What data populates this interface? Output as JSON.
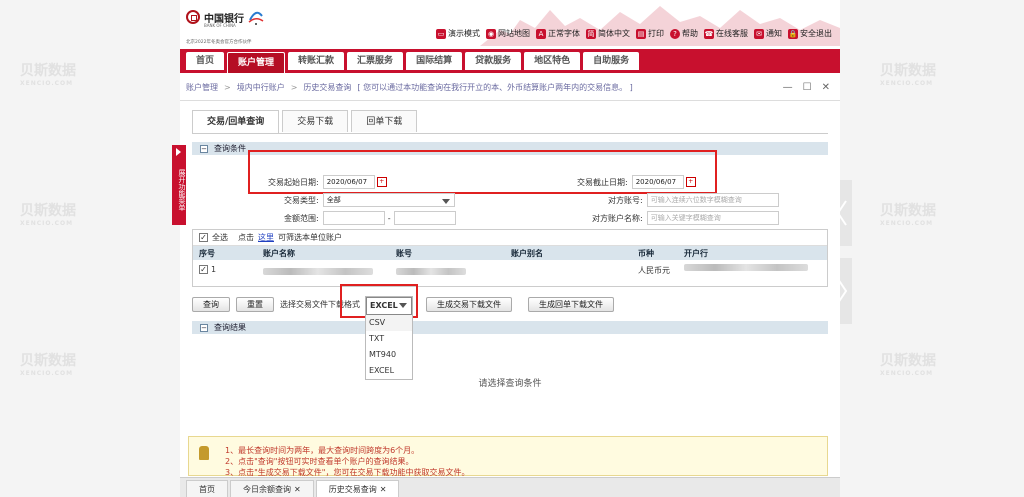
{
  "header": {
    "bank_name": "中国银行",
    "bank_name_en": "BANK OF CHINA",
    "slogan": "北京2022年冬奥会官方合作伙伴",
    "olympic": "BEIJING 2022",
    "toolbar": [
      {
        "icon": "monitor-icon",
        "label": "演示模式"
      },
      {
        "icon": "map-icon",
        "label": "网站地图"
      },
      {
        "icon": "font-icon",
        "label": "正常字体"
      },
      {
        "icon": "language-icon",
        "label": "简体中文"
      },
      {
        "icon": "printer-icon",
        "label": "打印"
      },
      {
        "icon": "help-icon",
        "label": "帮助"
      },
      {
        "icon": "service-icon",
        "label": "在线客服"
      },
      {
        "icon": "mail-icon",
        "label": "通知"
      },
      {
        "icon": "lock-icon",
        "label": "安全退出"
      }
    ]
  },
  "nav": {
    "items": [
      "首页",
      "账户管理",
      "转账汇款",
      "汇票服务",
      "国际结算",
      "贷款服务",
      "地区特色",
      "自助服务"
    ],
    "active": "账户管理"
  },
  "breadcrumb": {
    "items": [
      "账户管理",
      "境内中行账户",
      "历史交易查询"
    ],
    "hint": "[ 您可以通过本功能查询在我行开立的本、外币结算账户两年内的交易信息。 ]"
  },
  "tabs": [
    "交易/回单查询",
    "交易下载",
    "回单下载"
  ],
  "side_button": "展开功能菜单",
  "query": {
    "title": "查询条件",
    "start_date_label": "交易起始日期:",
    "start_date": "2020/06/07",
    "end_date_label": "交易截止日期:",
    "end_date": "2020/06/07",
    "type_label": "交易类型:",
    "type_value": "全部",
    "counter_account_label": "对方账号:",
    "counter_account_placeholder": "可输入连续六位数字模糊查询",
    "amount_label": "金额范围:",
    "amount_sep": "-",
    "counter_name_label": "对方账户名称:",
    "counter_name_placeholder": "可输入关键字模糊查询"
  },
  "accounts": {
    "select_all": "全选",
    "click_prefix": "点击",
    "click_link": "这里",
    "click_suffix": "可筛选本单位账户",
    "columns": [
      "序号",
      "账户名称",
      "账号",
      "账户别名",
      "币种",
      "开户行"
    ],
    "rows": [
      {
        "index": "1",
        "currency": "人民币元"
      }
    ]
  },
  "actions": {
    "query": "查询",
    "reset": "重置",
    "format_label": "选择交易文件下载格式",
    "format_selected": "EXCEL",
    "format_options": [
      "CSV",
      "TXT",
      "MT940",
      "EXCEL"
    ],
    "generate_trade": "生成交易下载文件",
    "generate_receipt": "生成回单下载文件"
  },
  "result": {
    "title": "查询结果",
    "empty": "请选择查询条件"
  },
  "notice": [
    "1、最长查询时间为两年，最大查询时间跨度为6个月。",
    "2、点击\"查询\"按钮可实时查看单个账户的查询结果。",
    "3、点击\"生成交易下载文件\"，您可在交易下载功能中获取交易文件。"
  ],
  "bottom_tabs": [
    {
      "label": "首页",
      "closable": false
    },
    {
      "label": "今日余额查询",
      "closable": true
    },
    {
      "label": "历史交易查询",
      "closable": true
    }
  ],
  "watermark": {
    "cn": "贝斯数据",
    "en": "XENCIO.COM"
  },
  "colors": {
    "brand": "#c8102e",
    "highlight": "#e02020",
    "section": "#d9e4ec"
  }
}
